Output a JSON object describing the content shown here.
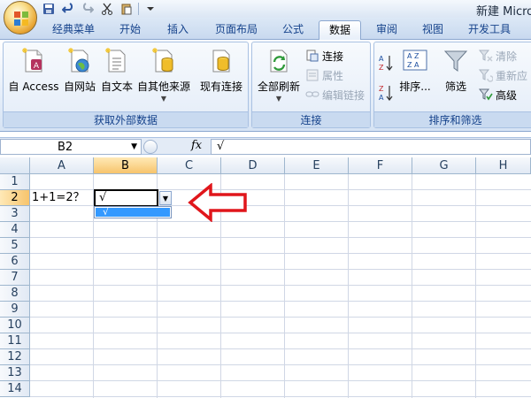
{
  "window": {
    "title": "新建 Micro"
  },
  "tabs": [
    {
      "label": "经典菜单",
      "active": false
    },
    {
      "label": "开始",
      "active": false
    },
    {
      "label": "插入",
      "active": false
    },
    {
      "label": "页面布局",
      "active": false
    },
    {
      "label": "公式",
      "active": false
    },
    {
      "label": "数据",
      "active": true
    },
    {
      "label": "审阅",
      "active": false
    },
    {
      "label": "视图",
      "active": false
    },
    {
      "label": "开发工具",
      "active": false
    }
  ],
  "ribbon": {
    "get_external_data": {
      "group_label": "获取外部数据",
      "from_access": "自 Access",
      "from_web": "自网站",
      "from_text": "自文本",
      "from_other": "自其他来源",
      "existing_connections": "现有连接"
    },
    "connections": {
      "group_label": "连接",
      "refresh_all": "全部刷新",
      "connections": "连接",
      "properties": "属性",
      "edit_links": "编辑链接"
    },
    "sort_filter": {
      "group_label": "排序和筛选",
      "sort": "排序...",
      "filter": "筛选",
      "clear": "清除",
      "reapply": "重新应",
      "advanced": "高级"
    }
  },
  "formula_bar": {
    "name_box": "B2",
    "fx": "fx",
    "content": "√"
  },
  "sheet": {
    "columns": [
      "A",
      "B",
      "C",
      "D",
      "E",
      "F",
      "G",
      "H"
    ],
    "active_column": "B",
    "rows": [
      "1",
      "2",
      "3",
      "4",
      "5",
      "6",
      "7",
      "8",
      "9",
      "10",
      "11",
      "12",
      "13",
      "14"
    ],
    "active_row": "2",
    "cells": {
      "A2": "1+1=2？",
      "B2": "√"
    },
    "dropdown_options": [
      "√"
    ]
  },
  "colors": {
    "selection_blue": "#3399ff",
    "annotation_red": "#e0161b",
    "active_header": "#f7c46c"
  }
}
